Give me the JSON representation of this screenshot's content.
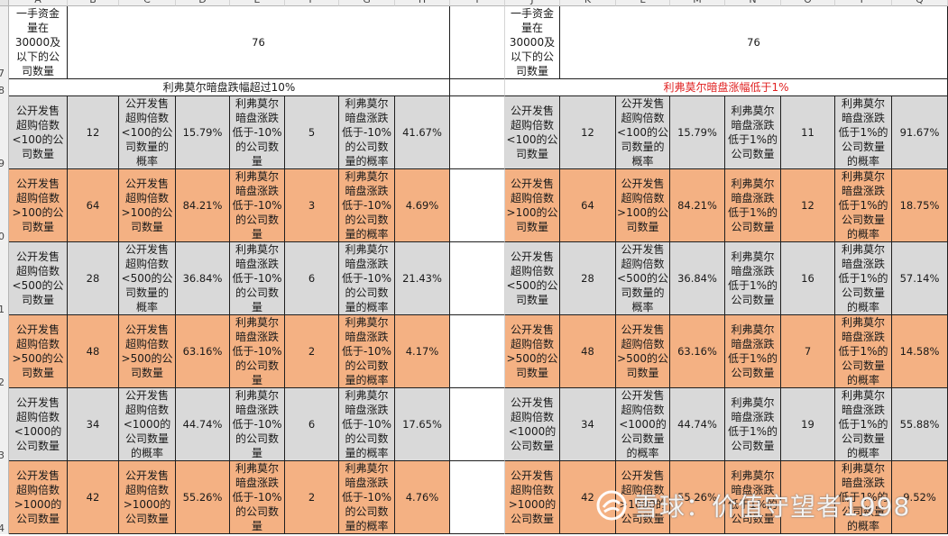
{
  "columns": [
    "A",
    "B",
    "C",
    "D",
    "E",
    "F",
    "G",
    "H",
    "I",
    "J",
    "K",
    "L",
    "M",
    "N",
    "O",
    "P",
    "Q"
  ],
  "rows": [
    "7",
    "8",
    "9",
    "0",
    "1",
    "2",
    "3",
    "4"
  ],
  "left_block": {
    "top_label": "一手资金\n量在\n30000及\n以下的公\n司数量",
    "top_value": "76",
    "section_title": "利弗莫尔暗盘跌幅超过10%"
  },
  "right_block": {
    "top_label": "一手资金\n量在\n30000及\n以下的公\n司数量",
    "top_value": "76",
    "section_title": "利弗莫尔暗盘涨幅低于1%"
  },
  "table_rows": [
    {
      "style": "gray",
      "a": "公开发售\n超购倍数\n<100的公\n司数量",
      "b": "12",
      "c": "公开发售\n超购倍数\n<100的公\n司数量的\n概率",
      "d": "15.79%",
      "e": "利弗莫尔\n暗盘涨跌\n低于-10%\n的公司数\n量",
      "f": "5",
      "g": "利弗莫尔\n暗盘涨跌\n低于-10%\n的公司数\n量的概率",
      "h": "41.67%",
      "j": "公开发售\n超购倍数\n<100的公\n司数量",
      "k": "12",
      "l": "公开发售\n超购倍数\n<100的公\n司数量的\n概率",
      "m": "15.79%",
      "n": "利弗莫尔\n暗盘涨跌\n低于1%的\n公司数量",
      "o": "11",
      "p": "利弗莫尔\n暗盘涨跌\n低于1%的\n公司数量\n的概率",
      "q": "91.67%"
    },
    {
      "style": "orange",
      "a": "公开发售\n超购倍数\n>100的公\n司数量",
      "b": "64",
      "c": "公开发售\n超购倍数\n>100的公\n司数量",
      "d": "84.21%",
      "e": "利弗莫尔\n暗盘涨跌\n低于-10%\n的公司数\n量",
      "f": "3",
      "g": "利弗莫尔\n暗盘涨跌\n低于-10%\n的公司数\n量的概率",
      "h": "4.69%",
      "j": "公开发售\n超购倍数\n>100的公\n司数量",
      "k": "64",
      "l": "公开发售\n超购倍数\n>100的公\n司数量",
      "m": "84.21%",
      "n": "利弗莫尔\n暗盘涨跌\n低于1%的\n公司数量",
      "o": "12",
      "p": "利弗莫尔\n暗盘涨跌\n低于1%的\n公司数量\n的概率",
      "q": "18.75%"
    },
    {
      "style": "gray",
      "a": "公开发售\n超购倍数\n<500的公\n司数量",
      "b": "28",
      "c": "公开发售\n超购倍数\n<500的公\n司数量的\n概率",
      "d": "36.84%",
      "e": "利弗莫尔\n暗盘涨跌\n低于-10%\n的公司数\n量",
      "f": "6",
      "g": "利弗莫尔\n暗盘涨跌\n低于-10%\n的公司数\n量的概率",
      "h": "21.43%",
      "j": "公开发售\n超购倍数\n<500的公\n司数量",
      "k": "28",
      "l": "公开发售\n超购倍数\n<500的公\n司数量的\n概率",
      "m": "36.84%",
      "n": "利弗莫尔\n暗盘涨跌\n低于1%的\n公司数量",
      "o": "16",
      "p": "利弗莫尔\n暗盘涨跌\n低于1%的\n公司数量\n的概率",
      "q": "57.14%"
    },
    {
      "style": "orange",
      "a": "公开发售\n超购倍数\n>500的公\n司数量",
      "b": "48",
      "c": "公开发售\n超购倍数\n>500的公\n司数量",
      "d": "63.16%",
      "e": "利弗莫尔\n暗盘涨跌\n低于-10%\n的公司数\n量",
      "f": "2",
      "g": "利弗莫尔\n暗盘涨跌\n低于-10%\n的公司数\n量的概率",
      "h": "4.17%",
      "j": "公开发售\n超购倍数\n>500的公\n司数量",
      "k": "48",
      "l": "公开发售\n超购倍数\n>500的公\n司数量",
      "m": "63.16%",
      "n": "利弗莫尔\n暗盘涨跌\n低于1%的\n公司数量",
      "o": "7",
      "p": "利弗莫尔\n暗盘涨跌\n低于1%的\n公司数量\n的概率",
      "q": "14.58%"
    },
    {
      "style": "gray",
      "a": "公开发售\n超购倍数\n<1000的\n公司数量",
      "b": "34",
      "c": "公开发售\n超购倍数\n<1000的\n公司数量\n的概率",
      "d": "44.74%",
      "e": "利弗莫尔\n暗盘涨跌\n低于-10%\n的公司数\n量",
      "f": "6",
      "g": "利弗莫尔\n暗盘涨跌\n低于-10%\n的公司数\n量的概率",
      "h": "17.65%",
      "j": "公开发售\n超购倍数\n<1000的\n公司数量",
      "k": "34",
      "l": "公开发售\n超购倍数\n<1000的\n公司数量\n的概率",
      "m": "44.74%",
      "n": "利弗莫尔\n暗盘涨跌\n低于1%的\n公司数量",
      "o": "19",
      "p": "利弗莫尔\n暗盘涨跌\n低于1%的\n公司数量\n的概率",
      "q": "55.88%"
    },
    {
      "style": "orange",
      "a": "公开发售\n超购倍数\n>1000的\n公司数量",
      "b": "42",
      "c": "公开发售\n超购倍数\n>1000的\n公司数量",
      "d": "55.26%",
      "e": "利弗莫尔\n暗盘涨跌\n低于-10%\n的公司数\n量",
      "f": "2",
      "g": "利弗莫尔\n暗盘涨跌\n低于-10%\n的公司数\n量的概率",
      "h": "4.76%",
      "j": "公开发售\n超购倍数\n>1000的\n公司数量",
      "k": "42",
      "l": "公开发售\n超购倍数\n>1000的\n公司数量",
      "m": "55.26%",
      "n": "利弗莫尔\n暗盘涨跌\n低于1%的\n公司数量",
      "o": "",
      "p": "利弗莫尔\n暗盘涨跌\n低于1%的\n公司数量\n的概率",
      "q": "9.52%"
    }
  ],
  "watermark": "雪球：价值守望者1998",
  "colors": {
    "gray_row": "#d9d9d9",
    "orange_row": "#f4b183",
    "red_title": "#e02020"
  }
}
